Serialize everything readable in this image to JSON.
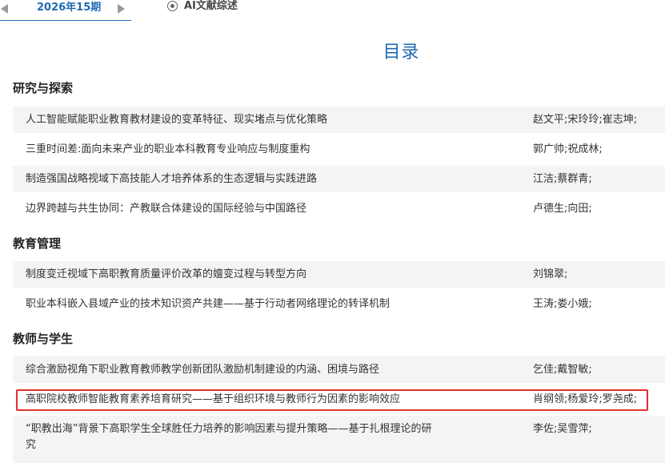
{
  "issue_nav": {
    "current_issue": "2026年15期",
    "ai_tab_label": "AI文献综述"
  },
  "page_title": "目录",
  "sections": [
    {
      "name": "研究与探索",
      "articles": [
        {
          "title": "人工智能赋能职业教育教材建设的变革特征、现实堵点与优化策略",
          "authors": "赵文平;宋玲玲;崔志坤;"
        },
        {
          "title": "三重时间差:面向未来产业的职业本科教育专业响应与制度重构",
          "authors": "郭广帅;祝成林;"
        },
        {
          "title": "制造强国战略视域下高技能人才培养体系的生态逻辑与实践进路",
          "authors": "江洁;蔡群青;"
        },
        {
          "title": "边界跨越与共生协同：产教联合体建设的国际经验与中国路径",
          "authors": "卢德生;向田;"
        }
      ]
    },
    {
      "name": "教育管理",
      "articles": [
        {
          "title": "制度变迁视域下高职教育质量评价改革的嬗变过程与转型方向",
          "authors": "刘锦翠;"
        },
        {
          "title": "职业本科嵌入县域产业的技术知识资产共建——基于行动者网络理论的转译机制",
          "authors": "王涛;娄小娥;"
        }
      ]
    },
    {
      "name": "教师与学生",
      "articles": [
        {
          "title": "综合激励视角下职业教育教师教学创新团队激励机制建设的内涵、困境与路径",
          "authors": "乞佳;戴智敏;"
        },
        {
          "title": "高职院校教师智能教育素养培育研究——基于组织环境与教师行为因素的影响效应",
          "authors": "肖纲领;杨爱玲;罗尧成;"
        },
        {
          "title": "“职教出海”背景下高职学生全球胜任力培养的影响因素与提升策略——基于扎根理论的研究",
          "authors": "李佐;吴雪萍;"
        }
      ]
    }
  ],
  "colors": {
    "accent": "#1f6ab1",
    "highlight": "#e0312f",
    "row_shade": "#f4f4f4"
  }
}
